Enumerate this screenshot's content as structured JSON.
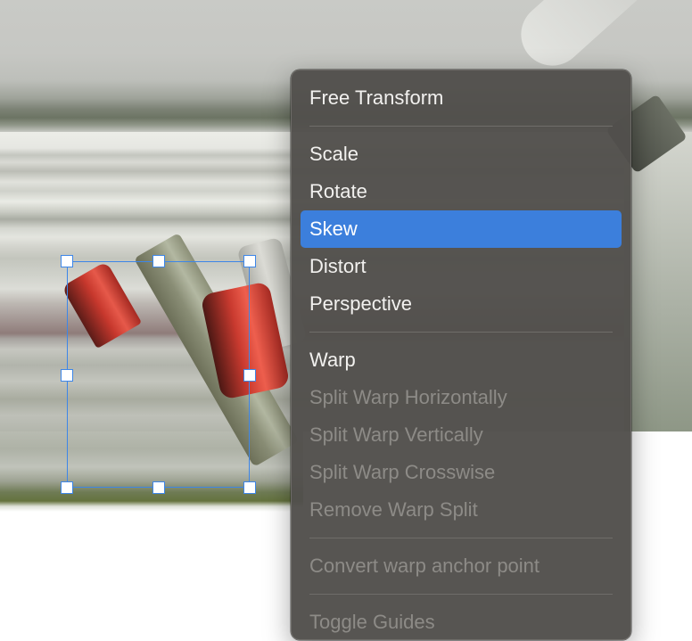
{
  "menu": {
    "items": [
      {
        "label": "Free Transform",
        "enabled": true
      },
      {
        "label": "Scale",
        "enabled": true
      },
      {
        "label": "Rotate",
        "enabled": true
      },
      {
        "label": "Skew",
        "enabled": true,
        "selected": true
      },
      {
        "label": "Distort",
        "enabled": true
      },
      {
        "label": "Perspective",
        "enabled": true
      },
      {
        "label": "Warp",
        "enabled": true
      },
      {
        "label": "Split Warp Horizontally",
        "enabled": false
      },
      {
        "label": "Split Warp Vertically",
        "enabled": false
      },
      {
        "label": "Split Warp Crosswise",
        "enabled": false
      },
      {
        "label": "Remove Warp Split",
        "enabled": false
      },
      {
        "label": "Convert warp anchor point",
        "enabled": false
      },
      {
        "label": "Toggle Guides",
        "enabled": false
      }
    ]
  },
  "colors": {
    "selection_highlight": "#3c7fdc",
    "transform_box": "#3d86e8",
    "menu_background": "#52504c"
  }
}
